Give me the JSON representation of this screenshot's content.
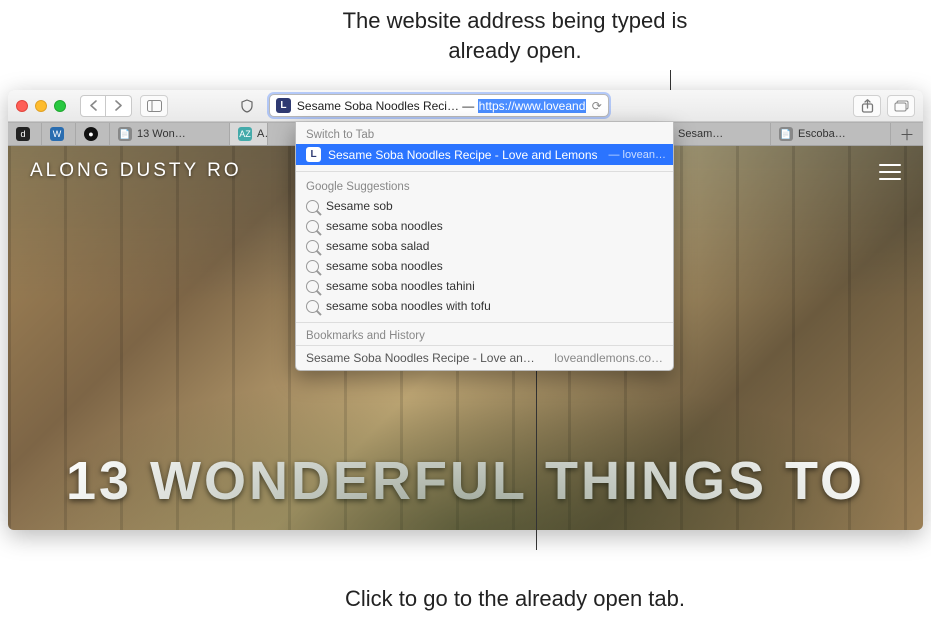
{
  "annotations": {
    "top": "The website address being typed is already open.",
    "bottom": "Click to go to the already open tab."
  },
  "toolbar": {
    "address_title": "Sesame Soba Noodles Reci… — ",
    "address_url": "https://www.loveandle…",
    "favicon_letter": "L"
  },
  "tabs": [
    {
      "favicon": "d",
      "label": ""
    },
    {
      "favicon": "W",
      "label": ""
    },
    {
      "favicon": "●",
      "label": ""
    },
    {
      "favicon": "📄",
      "label": "13 Won…"
    },
    {
      "favicon": "AZ",
      "label": "A…"
    },
    {
      "favicon": "L",
      "label": "Sesam…"
    },
    {
      "favicon": "📄",
      "label": "Escoba…"
    }
  ],
  "dropdown": {
    "switch_header": "Switch to Tab",
    "switch_item": {
      "title": "Sesame Soba Noodles Recipe - Love and Lemons",
      "sub": "— lovean…",
      "favicon": "L"
    },
    "google_header": "Google Suggestions",
    "suggestions": [
      "Sesame sob",
      "sesame soba noodles",
      "sesame soba salad",
      "sesame soba noodles",
      "sesame soba noodles tahini",
      "sesame soba noodles with tofu"
    ],
    "bh_header": "Bookmarks and History",
    "bh_title": "Sesame Soba Noodles Recipe - Love an…",
    "bh_domain": "loveandlemons.co…"
  },
  "page": {
    "site_title": "ALONG DUSTY RO",
    "headline": "13 WONDERFUL THINGS TO"
  }
}
